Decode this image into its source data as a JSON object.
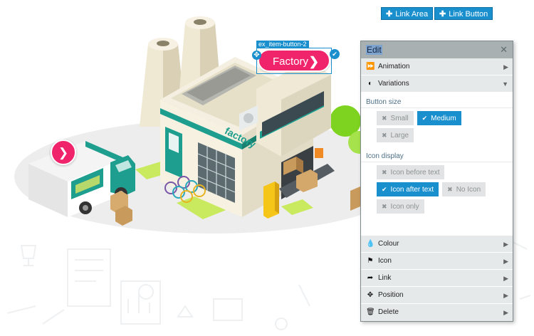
{
  "toolbar": {
    "link_area_label": "Link Area",
    "link_button_label": "Link Button"
  },
  "canvas": {
    "selected_item_id": "ex_item-button-2",
    "factory_button_label": "Factory",
    "factory_sign_text": "factory"
  },
  "panel": {
    "title": "Edit",
    "sections_top": [
      {
        "label": "Animation",
        "icon": "fast-forward-icon"
      },
      {
        "label": "Variations",
        "icon": "half-circle-icon"
      }
    ],
    "button_size": {
      "label": "Button size",
      "options": [
        {
          "label": "Small",
          "active": false
        },
        {
          "label": "Medium",
          "active": true
        },
        {
          "label": "Large",
          "active": false
        }
      ]
    },
    "icon_display": {
      "label": "Icon display",
      "options": [
        {
          "label": "Icon before text",
          "active": false
        },
        {
          "label": "Icon after text",
          "active": true
        },
        {
          "label": "No Icon",
          "active": false
        },
        {
          "label": "Icon only",
          "active": false
        }
      ]
    },
    "sections_bottom": [
      {
        "label": "Colour",
        "icon": "drop-icon"
      },
      {
        "label": "Icon",
        "icon": "flag-icon"
      },
      {
        "label": "Link",
        "icon": "share-arrow-icon"
      },
      {
        "label": "Position",
        "icon": "move-icon"
      },
      {
        "label": "Delete",
        "icon": "trash-icon"
      }
    ]
  },
  "colors": {
    "accent_blue": "#1a8fce",
    "hotspot_pink": "#f0246b",
    "teal": "#1e9e8e"
  }
}
